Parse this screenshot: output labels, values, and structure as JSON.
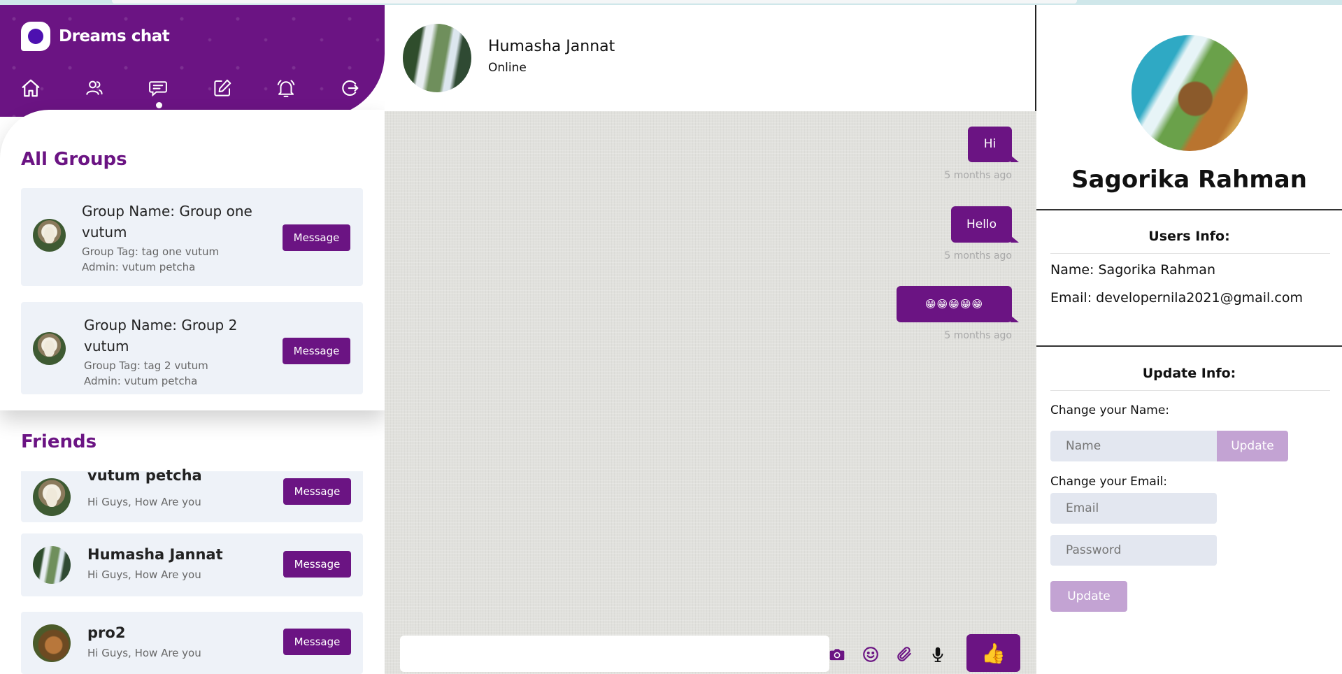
{
  "app": {
    "name": "Dreams chat"
  },
  "nav": {
    "icons": [
      "home-icon",
      "users-icon",
      "chat-icon",
      "edit-icon",
      "bell-icon",
      "logout-icon"
    ],
    "active": "chat-icon"
  },
  "groups": {
    "title": "All Groups",
    "items": [
      {
        "name_line1": "Group Name: Group one",
        "name_line2": "vutum",
        "tag": "Group Tag: tag one vutum",
        "admin": "Admin: vutum petcha",
        "button": "Message"
      },
      {
        "name_line1": "Group Name: Group 2",
        "name_line2": "vutum",
        "tag": "Group Tag: tag 2 vutum",
        "admin": "Admin: vutum petcha",
        "button": "Message"
      }
    ]
  },
  "friends": {
    "title": "Friends",
    "items": [
      {
        "name": "vutum petcha",
        "status": "Hi Guys, How Are you",
        "button": "Message"
      },
      {
        "name": "Humasha Jannat",
        "status": "Hi Guys, How Are you",
        "button": "Message"
      },
      {
        "name": "pro2",
        "status": "Hi Guys, How Are you",
        "button": "Message"
      }
    ]
  },
  "chat": {
    "contact_name": "Humasha Jannat",
    "contact_status": "Online",
    "messages": [
      {
        "text": "Hi",
        "time": "5 months ago"
      },
      {
        "text": "Hello",
        "time": "5 months ago"
      },
      {
        "text": "😁😁😁😁😁",
        "time": "5 months ago"
      }
    ],
    "composer_icons": [
      "camera-icon",
      "emoji-icon",
      "attach-icon",
      "mic-icon"
    ],
    "like_button": "👍"
  },
  "profile": {
    "name": "Sagorika Rahman",
    "users_info_title": "Users Info:",
    "name_line": "Name: Sagorika Rahman",
    "email_line": "Email: developernila2021@gmail.com",
    "update_title": "Update Info:",
    "change_name_label": "Change your Name:",
    "name_placeholder": "Name",
    "update_name_button": "Update",
    "change_email_label": "Change your Email:",
    "email_placeholder": "Email",
    "password_placeholder": "Password",
    "update_email_button": "Update"
  },
  "colors": {
    "accent": "#6b1483",
    "muted_button": "#c3a3d3",
    "card_bg": "#eef2f8",
    "chat_bg": "#e1e1dd"
  }
}
